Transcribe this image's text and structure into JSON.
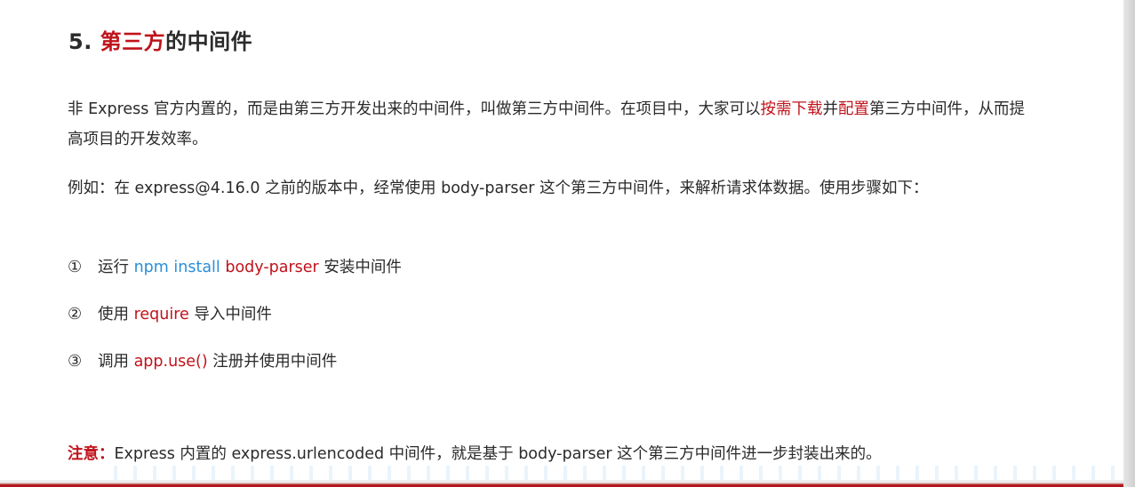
{
  "title": {
    "prefix": "5. ",
    "highlight": "第三方",
    "suffix": "的中间件"
  },
  "paragraph1": {
    "text_a": "非 Express 官方内置的，而是由第三方开发出来的中间件，叫做第三方中间件。在项目中，大家可以",
    "link_a": "按需下载",
    "text_b": "并",
    "link_b": "配置",
    "text_c": "第三方中间件，从而提高项目的开发效率。"
  },
  "paragraph2": {
    "text": "例如：在 express@4.16.0 之前的版本中，经常使用 body-parser 这个第三方中间件，来解析请求体数据。使用步骤如下："
  },
  "steps": [
    {
      "num": "①",
      "pre": "运行 ",
      "code_blue": "npm install",
      "space": " ",
      "code_red": "body-parser",
      "post": " 安装中间件"
    },
    {
      "num": "②",
      "pre": "使用 ",
      "code_red": "require",
      "post": " 导入中间件"
    },
    {
      "num": "③",
      "pre": "调用 ",
      "code_red": "app.use()",
      "post": " 注册并使用中间件"
    }
  ],
  "note": {
    "label": "注意：",
    "text": "Express 内置的 express.urlencoded 中间件，就是基于 body-parser 这个第三方中间件进一步封装出来的。"
  },
  "colors": {
    "accent_red": "#c0131b",
    "code_blue": "#2b8fd8",
    "text": "#2a2a2a"
  }
}
